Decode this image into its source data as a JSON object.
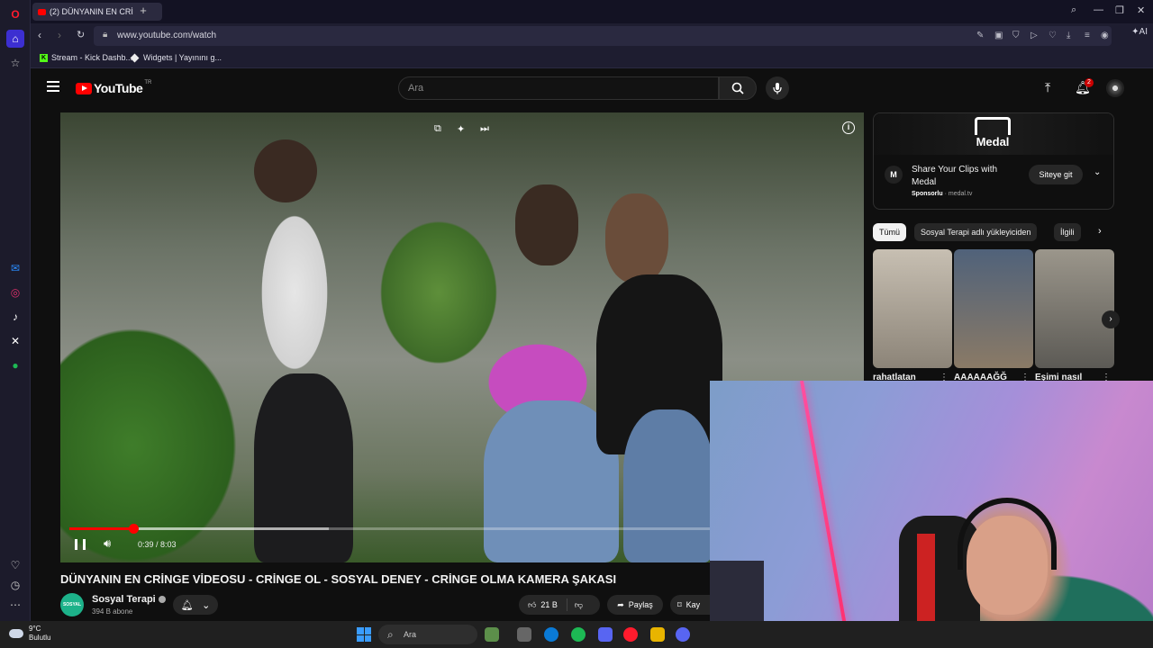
{
  "browser": {
    "tab": {
      "title": "(2) DÜNYANIN EN CRİ",
      "close": "×"
    },
    "new_tab": "+",
    "url": "www.youtube.com/watch",
    "ai_label": "AI",
    "window_controls": {
      "search": "⌕",
      "minimize": "—",
      "restore": "❐",
      "close": "✕"
    },
    "bookmarks": [
      {
        "label": "Stream - Kick Dashb...",
        "icon": "kick-icon"
      },
      {
        "label": "Widgets | Yayınını g...",
        "icon": "diamond-icon"
      }
    ]
  },
  "youtube": {
    "logo_text": "YouTube",
    "logo_region": "TR",
    "search_placeholder": "Ara",
    "notification_count": "2",
    "video": {
      "title": "DÜNYANIN EN CRİNGE VİDEOSU - CRİNGE OL - SOSYAL DENEY - CRİNGE OLMA KAMERA ŞAKASI",
      "time": "0:39 / 8:03",
      "progress": 0.081,
      "buffered": 0.33
    },
    "channel": {
      "name": "Sosyal Terapi",
      "subscribers": "394 B abone",
      "avatar_text": "SOSYAL TERAPİ"
    },
    "actions": {
      "likes": "21 B",
      "share": "Paylaş",
      "save": "Kay"
    },
    "ad": {
      "brand": "Medal",
      "title": "Share Your Clips with Medal",
      "sponsored": "Sponsorlu",
      "domain": "medal.tv",
      "cta": "Siteye git"
    },
    "chips": [
      "Tümü",
      "Sosyal Terapi adlı yükleyiciden",
      "İlgili"
    ],
    "shorts": [
      {
        "title": "rahatlatan",
        "color": "#b9b2a6"
      },
      {
        "title": "AAAAAAĞĞ",
        "color": "#5a6f86"
      },
      {
        "title": "Eşimi nasıl",
        "color": "#8a8478"
      }
    ]
  },
  "taskbar": {
    "temp": "9°C",
    "weather": "Bulutlu",
    "search": "Ara"
  },
  "colors": {
    "accent": "#ff0000",
    "background": "#0f0f0f",
    "opera_sidebar": "#1c1b2b"
  }
}
